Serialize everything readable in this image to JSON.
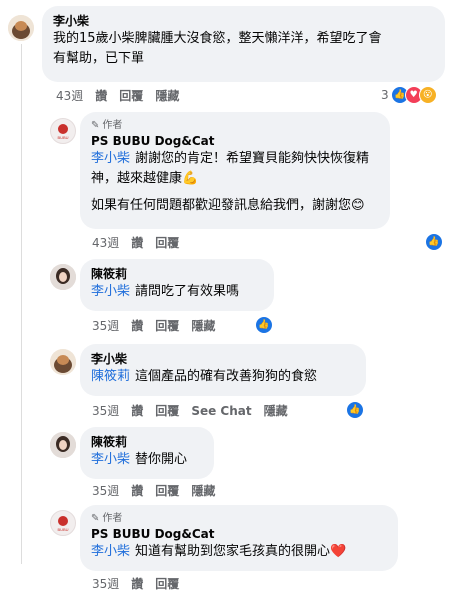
{
  "comments": [
    {
      "id": "c1",
      "author": "李小柴",
      "text_lines": [
        "我的15歲小柴脾臟腫大沒食慾，整天懶洋洋，希望吃了會",
        "有幫助，已下單"
      ],
      "time": "43週",
      "actions": [
        "讚",
        "回覆",
        "隱藏"
      ],
      "reaction_count": "3"
    },
    {
      "id": "c2",
      "author_tag": "作者",
      "author": "PS BUBU Dog&Cat",
      "mention": "李小柴",
      "text_lines": [
        "謝謝您的肯定！希望寶貝能夠快快恢復精",
        "神，越來越健康💪"
      ],
      "text_line3": "如果有任何問題都歡迎發訊息給我們，謝謝您😊",
      "time": "43週",
      "actions": [
        "讚",
        "回覆"
      ]
    },
    {
      "id": "c3",
      "author": "陳筱莉",
      "mention": "李小柴",
      "text": "請問吃了有效果嗎",
      "time": "35週",
      "actions": [
        "讚",
        "回覆",
        "隱藏"
      ]
    },
    {
      "id": "c4",
      "author": "李小柴",
      "mention": "陳筱莉",
      "text": "這個產品的確有改善狗狗的食慾",
      "time": "35週",
      "actions": [
        "讚",
        "回覆",
        "See Chat",
        "隱藏"
      ]
    },
    {
      "id": "c5",
      "author": "陳筱莉",
      "mention": "李小柴",
      "text": "替你開心",
      "time": "35週",
      "actions": [
        "讚",
        "回覆",
        "隱藏"
      ]
    },
    {
      "id": "c6",
      "author_tag": "作者",
      "author": "PS BUBU Dog&Cat",
      "mention": "李小柴",
      "text": "知道有幫助到您家毛孩真的很開心❤️",
      "time": "35週",
      "actions": [
        "讚",
        "回覆"
      ]
    }
  ],
  "colors": {
    "mention": "#216fdb",
    "bubble": "#f0f2f5",
    "like": "#1b74e4",
    "love": "#f33e58",
    "wow": "#f7b125"
  }
}
